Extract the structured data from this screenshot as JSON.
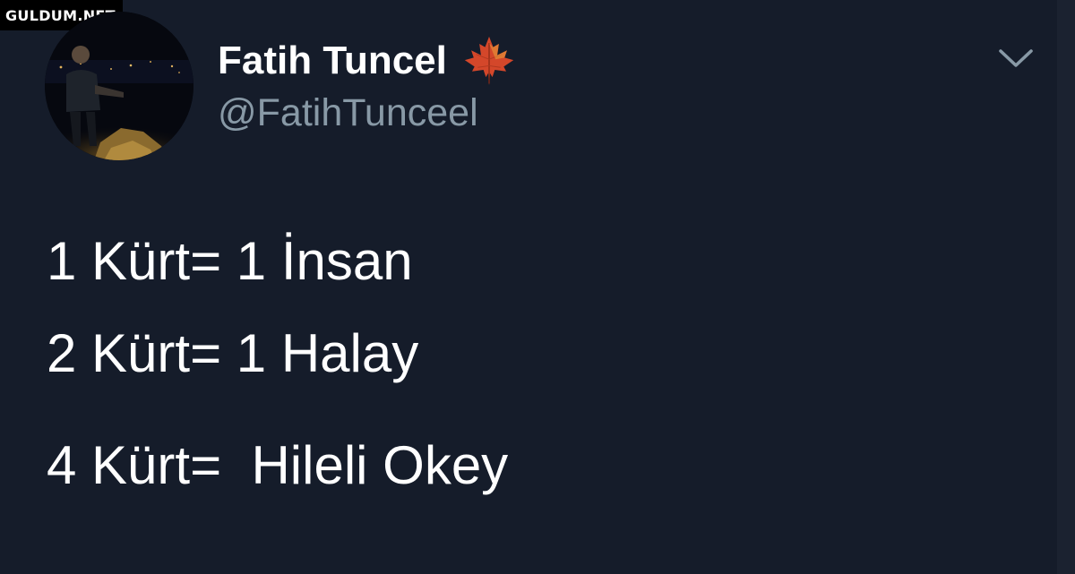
{
  "watermark": {
    "text": "GULDUM.NET"
  },
  "tweet": {
    "author": {
      "display_name": "Fatih Tuncel",
      "handle": "@FatihTunceel",
      "emoji_icon": "maple-leaf-icon"
    },
    "menu_icon": "chevron-down-icon",
    "lines": [
      "1 Kürt= 1 İnsan",
      "2 Kürt= 1 Halay",
      "4 Kürt=  Hileli Okey"
    ]
  },
  "colors": {
    "background": "#151c2a",
    "primary_text": "#ffffff",
    "secondary_text": "#8899a6"
  }
}
